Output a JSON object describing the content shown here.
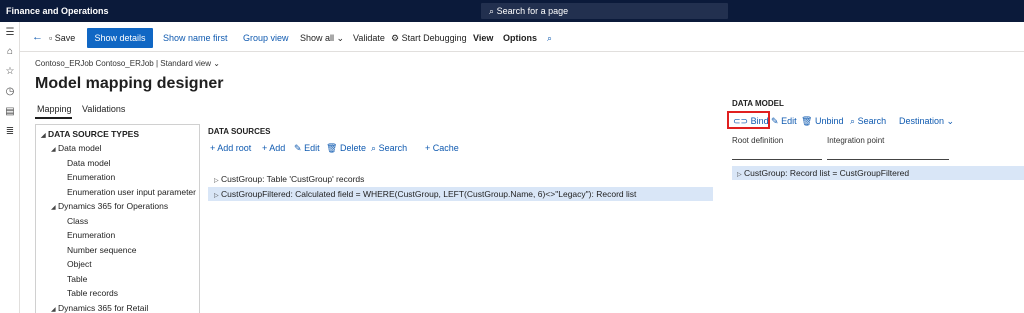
{
  "app": {
    "title": "Finance and Operations",
    "search_placeholder": "Search for a page"
  },
  "actions": {
    "save": "Save",
    "show_details": "Show details",
    "show_name_first": "Show name first",
    "group_view": "Group view",
    "show_all": "Show all",
    "validate": "Validate",
    "start_debugging": "Start Debugging",
    "view": "View",
    "options": "Options"
  },
  "breadcrumb": {
    "path": "Contoso_ERJob Contoso_ERJob",
    "separator": "|",
    "view": "Standard view"
  },
  "page_title": "Model mapping designer",
  "tabs": [
    {
      "label": "Mapping"
    },
    {
      "label": "Validations"
    }
  ],
  "tree": {
    "root": "DATA SOURCE TYPES",
    "items": [
      {
        "label": "Data model"
      },
      {
        "label": "Data model"
      },
      {
        "label": "Enumeration"
      },
      {
        "label": "Enumeration user input parameter"
      },
      {
        "label": "Dynamics 365 for Operations"
      },
      {
        "label": "Class"
      },
      {
        "label": "Enumeration"
      },
      {
        "label": "Number sequence"
      },
      {
        "label": "Object"
      },
      {
        "label": "Table"
      },
      {
        "label": "Table records"
      },
      {
        "label": "Dynamics 365 for Retail"
      }
    ]
  },
  "data_sources": {
    "heading": "DATA SOURCES",
    "toolbar": {
      "add_root": "Add root",
      "add": "Add",
      "edit": "Edit",
      "delete": "Delete",
      "search": "Search",
      "cache": "Cache"
    },
    "rows": [
      {
        "label": "CustGroup: Table 'CustGroup' records"
      },
      {
        "label": "CustGroupFiltered: Calculated field = WHERE(CustGroup, LEFT(CustGroup.Name, 6)<>\"Legacy\"): Record list"
      }
    ]
  },
  "data_model": {
    "heading": "DATA MODEL",
    "toolbar": {
      "bind": "Bind",
      "edit": "Edit",
      "unbind": "Unbind",
      "search": "Search",
      "destination": "Destination"
    },
    "fields": {
      "root_definition": "Root definition",
      "integration_point": "Integration point"
    },
    "rows": [
      {
        "label": "CustGroup: Record list = CustGroupFiltered"
      }
    ]
  },
  "colors": {
    "topbar": "#0b1a3a",
    "accent": "#1067c4",
    "link": "#0f5ab0",
    "selection": "#d9e6f7",
    "highlight": "#e02020"
  }
}
